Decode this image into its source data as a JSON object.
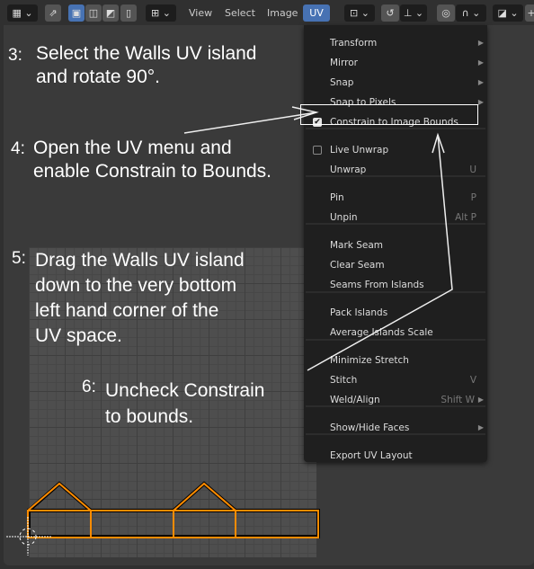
{
  "header": {
    "menus": [
      "View",
      "Select",
      "Image",
      "UV"
    ],
    "active_menu": "UV"
  },
  "notes": {
    "n3": {
      "num": "3:",
      "text": [
        "Select the Walls UV island",
        "and rotate 90°."
      ]
    },
    "n4": {
      "num": "4:",
      "text": [
        "Open the UV menu and",
        "enable Constrain to Bounds."
      ]
    },
    "n5": {
      "num": "5:",
      "text": [
        "Drag the Walls UV island",
        "down to the very bottom",
        "left hand corner of the",
        "UV space."
      ]
    },
    "n6": {
      "num": "6:",
      "text": [
        "Uncheck Constrain",
        "to bounds."
      ]
    }
  },
  "uv_menu": {
    "items": [
      {
        "label": "Transform",
        "submenu": true
      },
      {
        "label": "Mirror",
        "submenu": true
      },
      {
        "label": "Snap",
        "submenu": true
      },
      {
        "label": "Snap to Pixels",
        "submenu": true
      },
      {
        "label": "Constrain to Image Bounds",
        "checkbox": true,
        "checked": true
      },
      {
        "label": "Live Unwrap",
        "checkbox": true,
        "checked": false
      },
      {
        "label": "Unwrap",
        "shortcut": "U"
      },
      {
        "label": "Pin",
        "shortcut": "P"
      },
      {
        "label": "Unpin",
        "shortcut": "Alt P"
      },
      {
        "label": "Mark Seam"
      },
      {
        "label": "Clear Seam"
      },
      {
        "label": "Seams From Islands"
      },
      {
        "label": "Pack Islands"
      },
      {
        "label": "Average Islands Scale"
      },
      {
        "label": "Minimize Stretch"
      },
      {
        "label": "Stitch",
        "shortcut": "V"
      },
      {
        "label": "Weld/Align",
        "shortcut": "Shift W",
        "submenu": true
      },
      {
        "label": "Show/Hide Faces",
        "submenu": true
      },
      {
        "label": "Export UV Layout"
      }
    ]
  },
  "colors": {
    "accent": "#4772b3",
    "uv_edges": "#ff8c00",
    "menu_bg": "#1f1f1f"
  }
}
